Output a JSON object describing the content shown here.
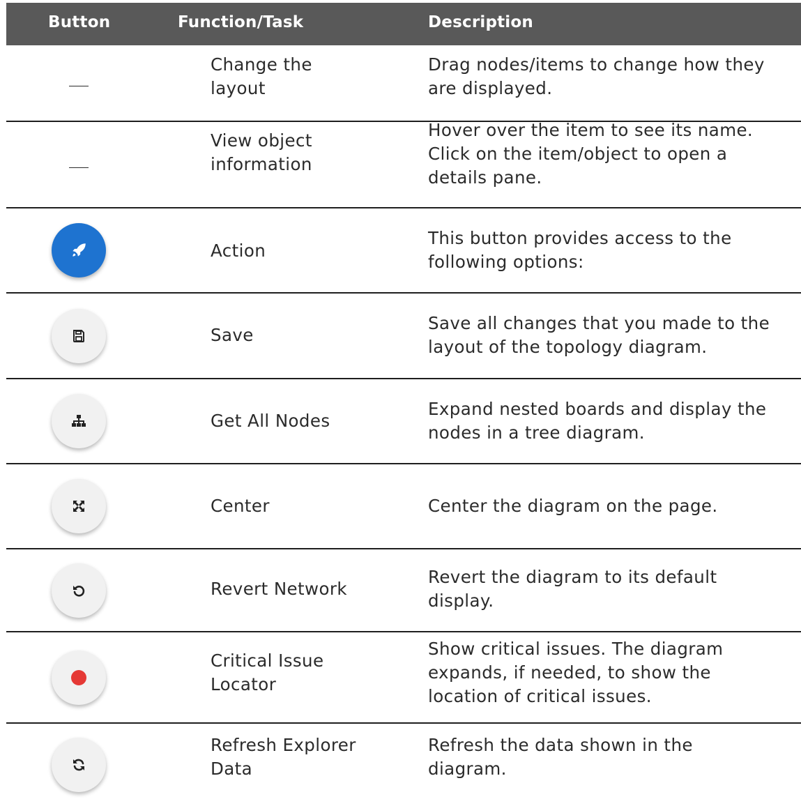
{
  "header": {
    "col1": "Button",
    "col2": "Function/Task",
    "col3": "Description"
  },
  "rows": [
    {
      "icon": "dash",
      "func": [
        "Change the",
        "layout"
      ],
      "desc": [
        "Drag nodes/items to change how they",
        "are displayed."
      ]
    },
    {
      "icon": "dash",
      "func": [
        "View object",
        "information"
      ],
      "desc": [
        "Hover over the item to see its name.",
        "Click on the item/object to open a",
        "details pane."
      ]
    },
    {
      "icon": "rocket-icon",
      "func": [
        "Action"
      ],
      "desc": [
        "This button provides access to the",
        "following options:"
      ]
    },
    {
      "icon": "save-icon",
      "func": [
        "Save"
      ],
      "desc": [
        "Save all changes that you made to the",
        "layout of the topology diagram."
      ]
    },
    {
      "icon": "sitemap-icon",
      "func": [
        "Get All Nodes"
      ],
      "desc": [
        "Expand nested boards and display the",
        "nodes in a tree diagram."
      ]
    },
    {
      "icon": "expand-icon",
      "func": [
        "Center"
      ],
      "desc": [
        "Center the diagram on the page."
      ]
    },
    {
      "icon": "undo-icon",
      "func": [
        "Revert Network"
      ],
      "desc": [
        "Revert the diagram to its default",
        "display."
      ]
    },
    {
      "icon": "red-dot-icon",
      "func": [
        "Critical Issue",
        "Locator"
      ],
      "desc": [
        "Show critical issues. The diagram",
        "expands, if needed, to show the",
        "location of critical issues."
      ]
    },
    {
      "icon": "refresh-icon",
      "func": [
        "Refresh Explorer",
        "Data"
      ],
      "desc": [
        "Refresh the data shown in the",
        "diagram."
      ]
    }
  ],
  "colors": {
    "header_bg": "#595959",
    "action_blue": "#1e73d0",
    "critical_red": "#e53935"
  }
}
